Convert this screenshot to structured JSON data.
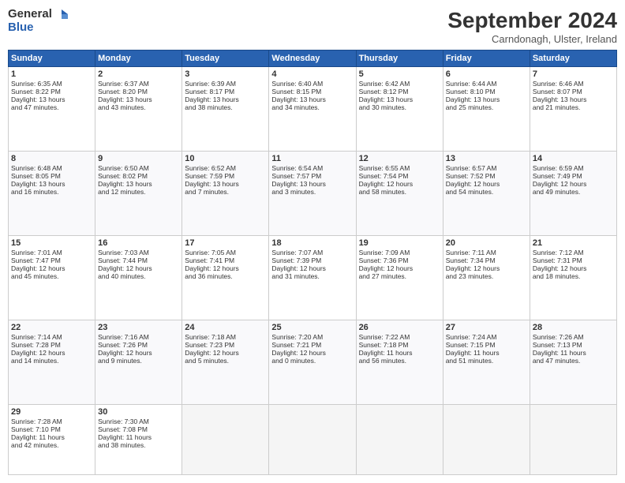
{
  "header": {
    "logo_line1": "General",
    "logo_line2": "Blue",
    "month": "September 2024",
    "location": "Carndonagh, Ulster, Ireland"
  },
  "weekdays": [
    "Sunday",
    "Monday",
    "Tuesday",
    "Wednesday",
    "Thursday",
    "Friday",
    "Saturday"
  ],
  "weeks": [
    [
      {
        "day": "1",
        "lines": [
          "Sunrise: 6:35 AM",
          "Sunset: 8:22 PM",
          "Daylight: 13 hours",
          "and 47 minutes."
        ]
      },
      {
        "day": "2",
        "lines": [
          "Sunrise: 6:37 AM",
          "Sunset: 8:20 PM",
          "Daylight: 13 hours",
          "and 43 minutes."
        ]
      },
      {
        "day": "3",
        "lines": [
          "Sunrise: 6:39 AM",
          "Sunset: 8:17 PM",
          "Daylight: 13 hours",
          "and 38 minutes."
        ]
      },
      {
        "day": "4",
        "lines": [
          "Sunrise: 6:40 AM",
          "Sunset: 8:15 PM",
          "Daylight: 13 hours",
          "and 34 minutes."
        ]
      },
      {
        "day": "5",
        "lines": [
          "Sunrise: 6:42 AM",
          "Sunset: 8:12 PM",
          "Daylight: 13 hours",
          "and 30 minutes."
        ]
      },
      {
        "day": "6",
        "lines": [
          "Sunrise: 6:44 AM",
          "Sunset: 8:10 PM",
          "Daylight: 13 hours",
          "and 25 minutes."
        ]
      },
      {
        "day": "7",
        "lines": [
          "Sunrise: 6:46 AM",
          "Sunset: 8:07 PM",
          "Daylight: 13 hours",
          "and 21 minutes."
        ]
      }
    ],
    [
      {
        "day": "8",
        "lines": [
          "Sunrise: 6:48 AM",
          "Sunset: 8:05 PM",
          "Daylight: 13 hours",
          "and 16 minutes."
        ]
      },
      {
        "day": "9",
        "lines": [
          "Sunrise: 6:50 AM",
          "Sunset: 8:02 PM",
          "Daylight: 13 hours",
          "and 12 minutes."
        ]
      },
      {
        "day": "10",
        "lines": [
          "Sunrise: 6:52 AM",
          "Sunset: 7:59 PM",
          "Daylight: 13 hours",
          "and 7 minutes."
        ]
      },
      {
        "day": "11",
        "lines": [
          "Sunrise: 6:54 AM",
          "Sunset: 7:57 PM",
          "Daylight: 13 hours",
          "and 3 minutes."
        ]
      },
      {
        "day": "12",
        "lines": [
          "Sunrise: 6:55 AM",
          "Sunset: 7:54 PM",
          "Daylight: 12 hours",
          "and 58 minutes."
        ]
      },
      {
        "day": "13",
        "lines": [
          "Sunrise: 6:57 AM",
          "Sunset: 7:52 PM",
          "Daylight: 12 hours",
          "and 54 minutes."
        ]
      },
      {
        "day": "14",
        "lines": [
          "Sunrise: 6:59 AM",
          "Sunset: 7:49 PM",
          "Daylight: 12 hours",
          "and 49 minutes."
        ]
      }
    ],
    [
      {
        "day": "15",
        "lines": [
          "Sunrise: 7:01 AM",
          "Sunset: 7:47 PM",
          "Daylight: 12 hours",
          "and 45 minutes."
        ]
      },
      {
        "day": "16",
        "lines": [
          "Sunrise: 7:03 AM",
          "Sunset: 7:44 PM",
          "Daylight: 12 hours",
          "and 40 minutes."
        ]
      },
      {
        "day": "17",
        "lines": [
          "Sunrise: 7:05 AM",
          "Sunset: 7:41 PM",
          "Daylight: 12 hours",
          "and 36 minutes."
        ]
      },
      {
        "day": "18",
        "lines": [
          "Sunrise: 7:07 AM",
          "Sunset: 7:39 PM",
          "Daylight: 12 hours",
          "and 31 minutes."
        ]
      },
      {
        "day": "19",
        "lines": [
          "Sunrise: 7:09 AM",
          "Sunset: 7:36 PM",
          "Daylight: 12 hours",
          "and 27 minutes."
        ]
      },
      {
        "day": "20",
        "lines": [
          "Sunrise: 7:11 AM",
          "Sunset: 7:34 PM",
          "Daylight: 12 hours",
          "and 23 minutes."
        ]
      },
      {
        "day": "21",
        "lines": [
          "Sunrise: 7:12 AM",
          "Sunset: 7:31 PM",
          "Daylight: 12 hours",
          "and 18 minutes."
        ]
      }
    ],
    [
      {
        "day": "22",
        "lines": [
          "Sunrise: 7:14 AM",
          "Sunset: 7:28 PM",
          "Daylight: 12 hours",
          "and 14 minutes."
        ]
      },
      {
        "day": "23",
        "lines": [
          "Sunrise: 7:16 AM",
          "Sunset: 7:26 PM",
          "Daylight: 12 hours",
          "and 9 minutes."
        ]
      },
      {
        "day": "24",
        "lines": [
          "Sunrise: 7:18 AM",
          "Sunset: 7:23 PM",
          "Daylight: 12 hours",
          "and 5 minutes."
        ]
      },
      {
        "day": "25",
        "lines": [
          "Sunrise: 7:20 AM",
          "Sunset: 7:21 PM",
          "Daylight: 12 hours",
          "and 0 minutes."
        ]
      },
      {
        "day": "26",
        "lines": [
          "Sunrise: 7:22 AM",
          "Sunset: 7:18 PM",
          "Daylight: 11 hours",
          "and 56 minutes."
        ]
      },
      {
        "day": "27",
        "lines": [
          "Sunrise: 7:24 AM",
          "Sunset: 7:15 PM",
          "Daylight: 11 hours",
          "and 51 minutes."
        ]
      },
      {
        "day": "28",
        "lines": [
          "Sunrise: 7:26 AM",
          "Sunset: 7:13 PM",
          "Daylight: 11 hours",
          "and 47 minutes."
        ]
      }
    ],
    [
      {
        "day": "29",
        "lines": [
          "Sunrise: 7:28 AM",
          "Sunset: 7:10 PM",
          "Daylight: 11 hours",
          "and 42 minutes."
        ]
      },
      {
        "day": "30",
        "lines": [
          "Sunrise: 7:30 AM",
          "Sunset: 7:08 PM",
          "Daylight: 11 hours",
          "and 38 minutes."
        ]
      },
      {
        "day": "",
        "lines": []
      },
      {
        "day": "",
        "lines": []
      },
      {
        "day": "",
        "lines": []
      },
      {
        "day": "",
        "lines": []
      },
      {
        "day": "",
        "lines": []
      }
    ]
  ]
}
